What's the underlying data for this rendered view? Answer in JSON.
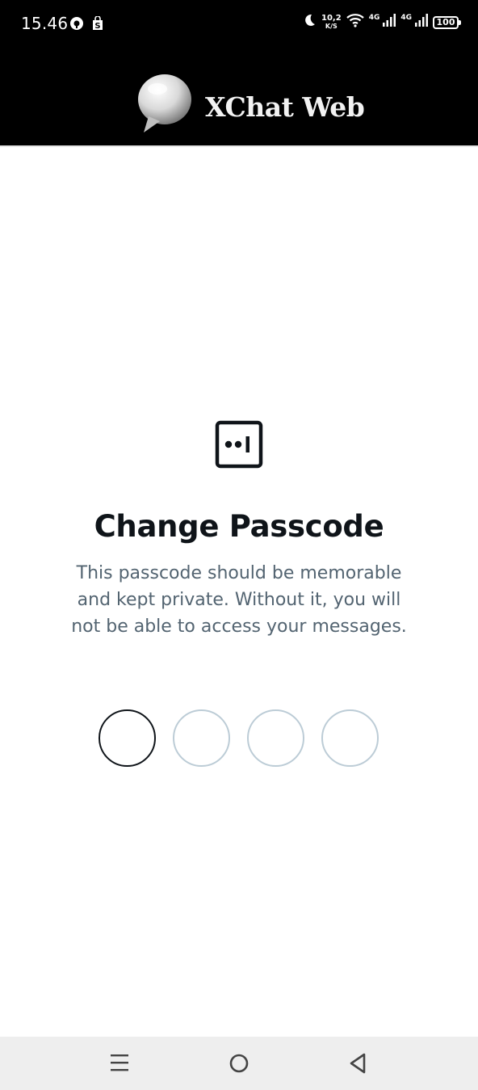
{
  "status_bar": {
    "time": "15.46",
    "net_speed_value": "10,2",
    "net_speed_unit": "K/S",
    "network_1": "4G",
    "network_2": "4G",
    "battery": "100"
  },
  "header": {
    "app_title": "XChat Web"
  },
  "main": {
    "title": "Change Passcode",
    "description": "This passcode should be memorable and kept private. Without it, you will not be able to access your messages.",
    "passcode_length": 4,
    "digits_entered": 0
  },
  "colors": {
    "header_bg": "#000000",
    "title": "#0f1419",
    "description": "#536471",
    "dot_active": "#0f1419",
    "dot_inactive": "#bcccd6",
    "navbar_bg": "#eeeeee"
  }
}
